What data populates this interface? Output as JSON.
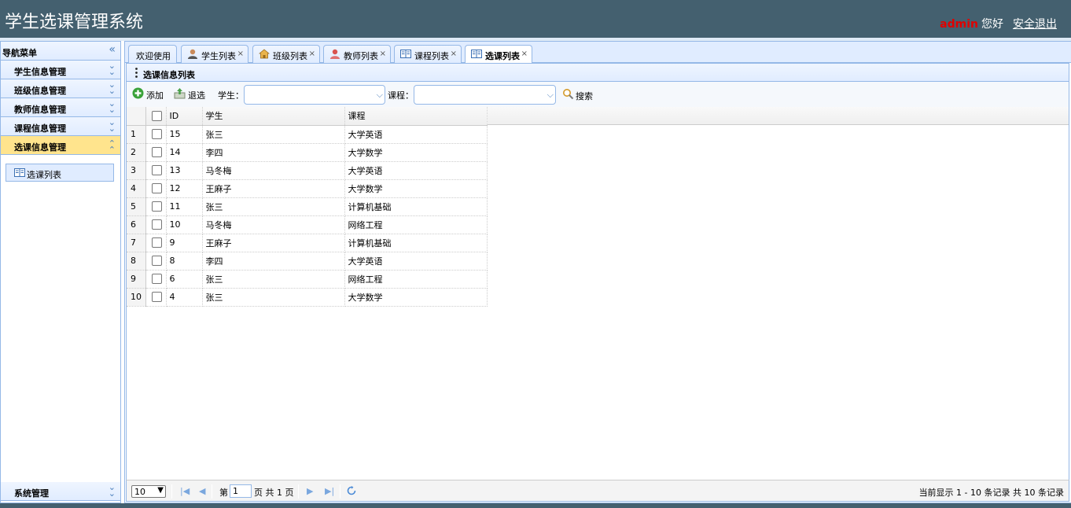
{
  "header": {
    "title": "学生选课管理系统",
    "username": "admin",
    "greeting": "您好",
    "logout_label": "安全退出"
  },
  "sidebar": {
    "title": "导航菜单",
    "items": [
      {
        "label": "学生信息管理"
      },
      {
        "label": "班级信息管理"
      },
      {
        "label": "教师信息管理"
      },
      {
        "label": "课程信息管理"
      },
      {
        "label": "选课信息管理"
      }
    ],
    "active_link": "选课列表",
    "bottom_item": "系统管理"
  },
  "tabs": [
    {
      "label": "欢迎使用",
      "icon": "none"
    },
    {
      "label": "学生列表",
      "icon": "user-icon"
    },
    {
      "label": "班级列表",
      "icon": "home-icon"
    },
    {
      "label": "教师列表",
      "icon": "teacher-icon"
    },
    {
      "label": "课程列表",
      "icon": "book-icon"
    },
    {
      "label": "选课列表",
      "icon": "book-icon"
    }
  ],
  "close_symbol": "×",
  "panel": {
    "title": "选课信息列表"
  },
  "toolbar": {
    "add_label": "添加",
    "withdraw_label": "退选",
    "student_label": "学生：",
    "course_label": "课程：",
    "search_label": "搜索"
  },
  "grid": {
    "columns": [
      "ID",
      "学生",
      "课程"
    ],
    "rows": [
      {
        "n": "1",
        "id": "15",
        "student": "张三",
        "course": "大学英语"
      },
      {
        "n": "2",
        "id": "14",
        "student": "李四",
        "course": "大学数学"
      },
      {
        "n": "3",
        "id": "13",
        "student": "马冬梅",
        "course": "大学英语"
      },
      {
        "n": "4",
        "id": "12",
        "student": "王麻子",
        "course": "大学数学"
      },
      {
        "n": "5",
        "id": "11",
        "student": "张三",
        "course": "计算机基础"
      },
      {
        "n": "6",
        "id": "10",
        "student": "马冬梅",
        "course": "网络工程"
      },
      {
        "n": "7",
        "id": "9",
        "student": "王麻子",
        "course": "计算机基础"
      },
      {
        "n": "8",
        "id": "8",
        "student": "李四",
        "course": "大学英语"
      },
      {
        "n": "9",
        "id": "6",
        "student": "张三",
        "course": "网络工程"
      },
      {
        "n": "10",
        "id": "4",
        "student": "张三",
        "course": "大学数学"
      }
    ]
  },
  "pager": {
    "page_size": "10",
    "page_prefix": "第",
    "current_page": "1",
    "page_suffix": "页 共 1 页",
    "info": "当前显示 1 - 10 条记录 共 10 条记录"
  },
  "colors": {
    "header_bg": "#44606f",
    "border": "#95b8e7",
    "accent_active": "#ffe48d",
    "username": "#e00000"
  }
}
